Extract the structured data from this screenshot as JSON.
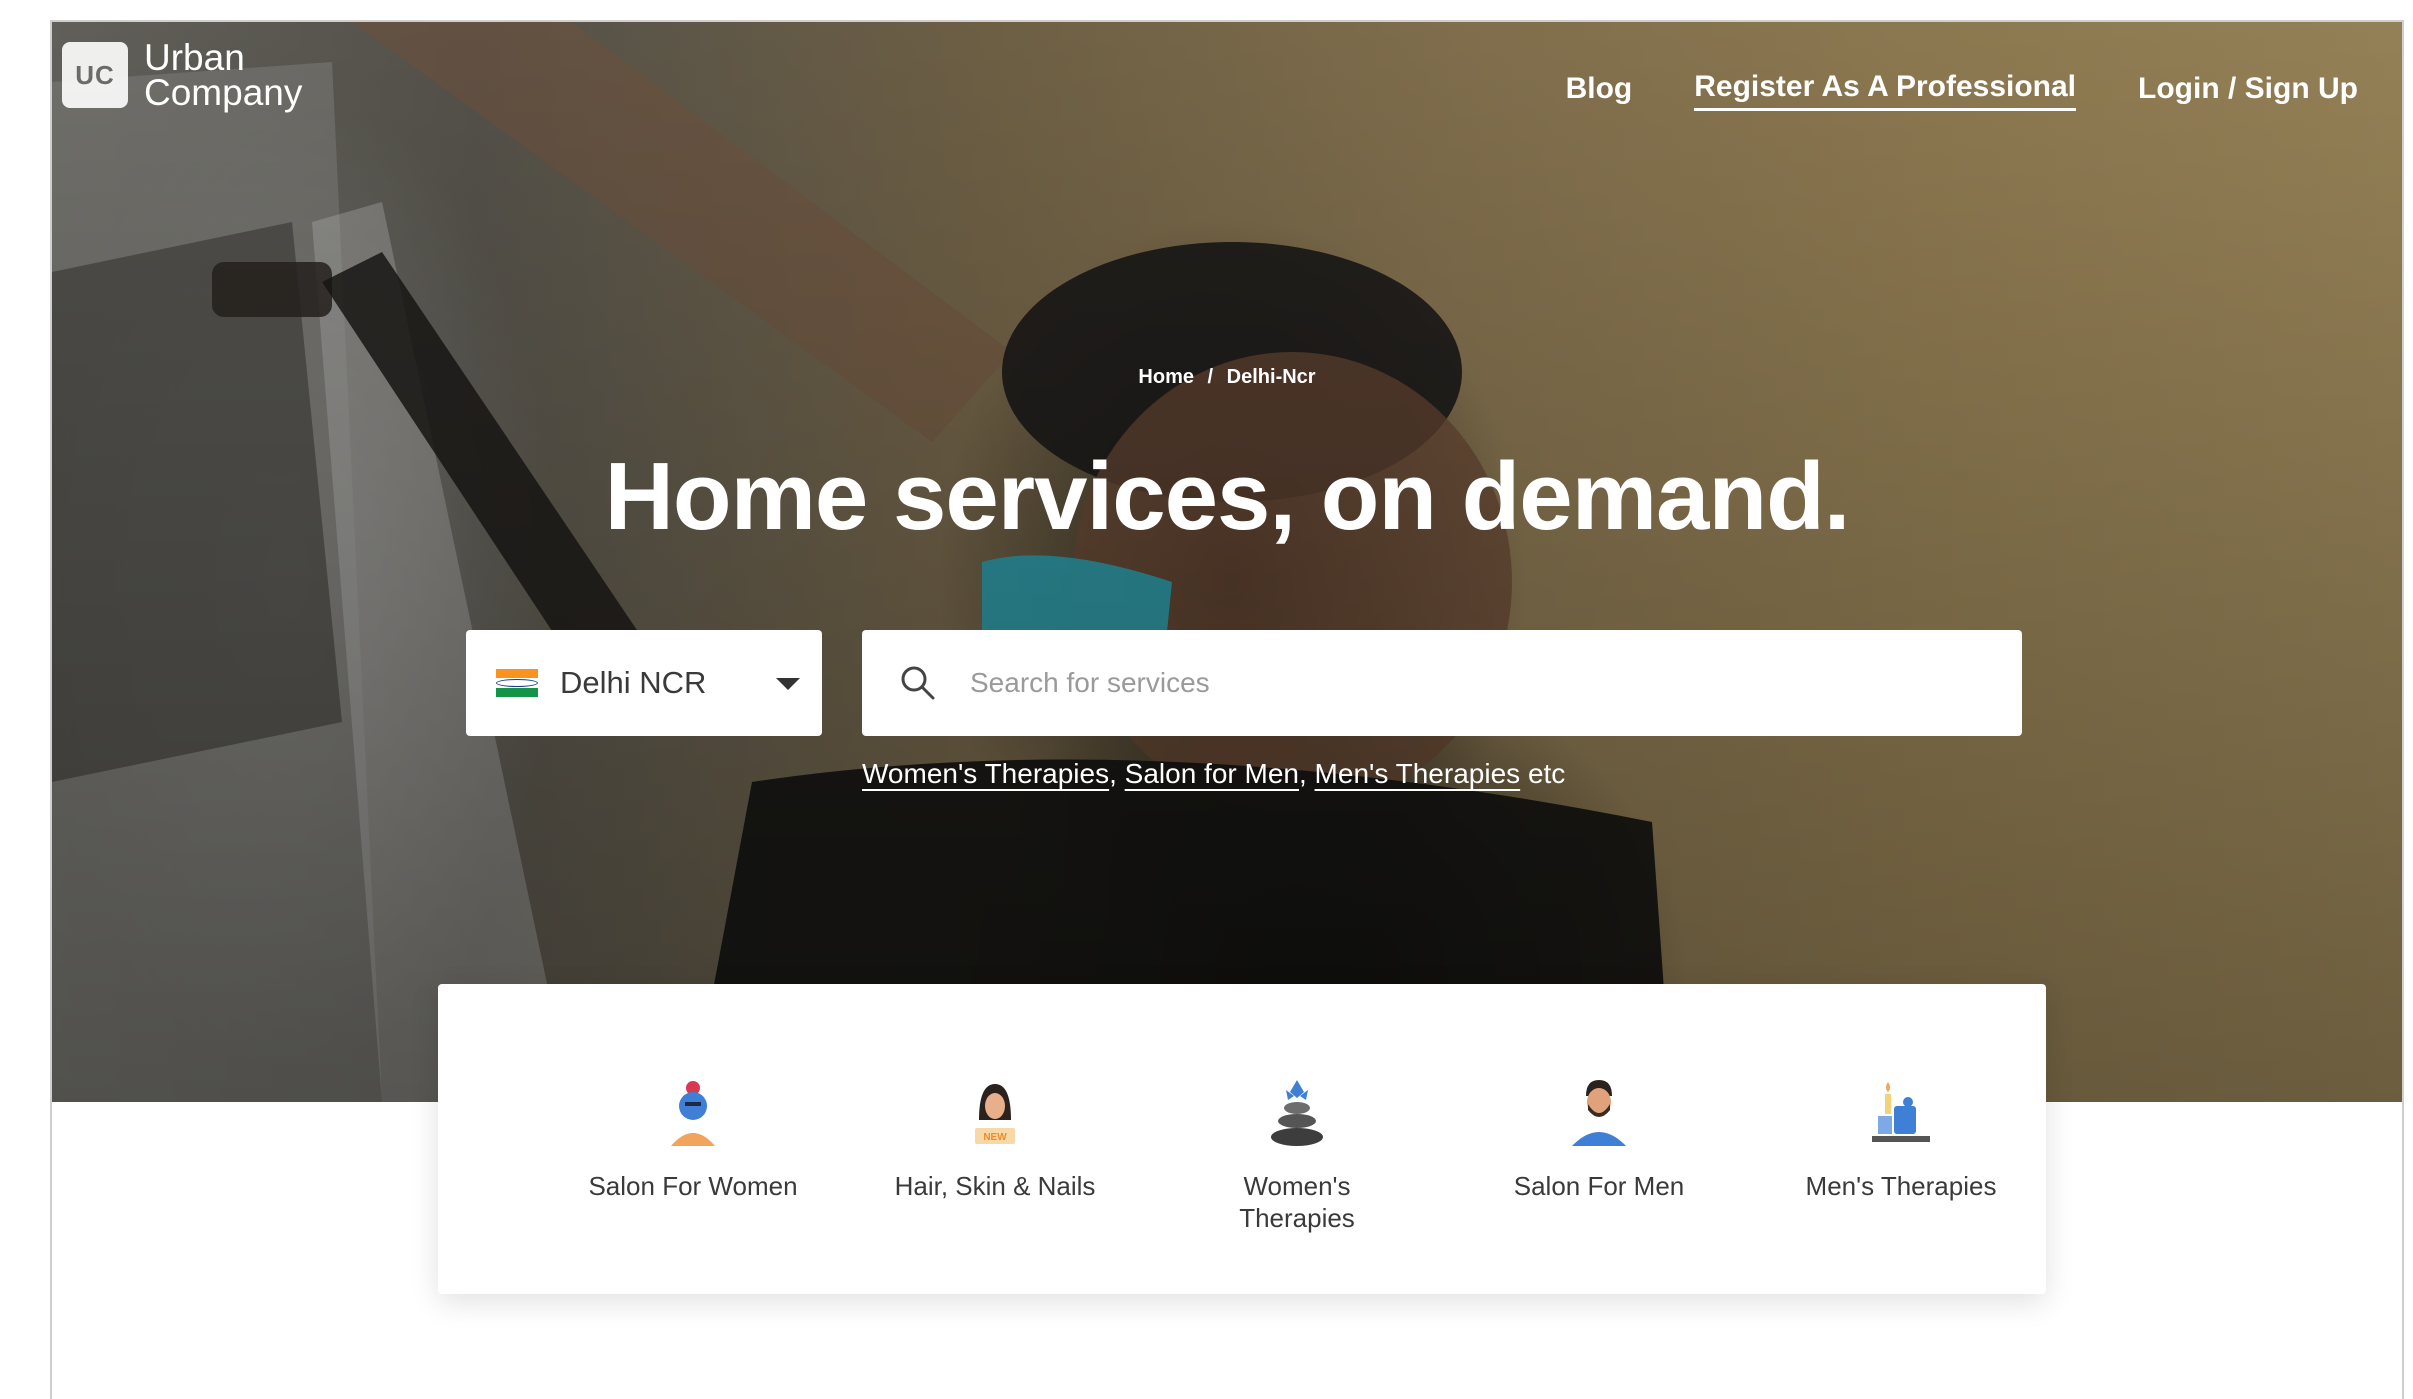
{
  "brand": {
    "logo_mark": "UC",
    "name_line1": "Urban",
    "name_line2": "Company"
  },
  "nav": {
    "blog": "Blog",
    "register": "Register As A Professional",
    "login": "Login / Sign Up"
  },
  "breadcrumb": {
    "home": "Home",
    "separator": "/",
    "current": "Delhi-Ncr"
  },
  "hero": {
    "headline": "Home services, on demand."
  },
  "city": {
    "selected": "Delhi NCR",
    "flag_icon": "india-flag-icon"
  },
  "search": {
    "placeholder": "Search for services"
  },
  "suggestions": {
    "links": [
      "Women's Therapies",
      "Salon for Men",
      "Men's Therapies"
    ],
    "suffix": "etc"
  },
  "categories": [
    {
      "label": "Salon For Women",
      "icon": "woman-facial-icon"
    },
    {
      "label": "Hair, Skin & Nails",
      "icon": "woman-new-icon",
      "badge": "NEW"
    },
    {
      "label_line1": "Women's",
      "label_line2": "Therapies",
      "icon": "spa-stones-icon"
    },
    {
      "label": "Salon For Men",
      "icon": "man-beard-icon"
    },
    {
      "label": "Men's Therapies",
      "icon": "massage-candle-icon"
    }
  ],
  "colors": {
    "accent": "#6e42e5",
    "flag_saffron": "#f7931e",
    "flag_green": "#139447"
  }
}
